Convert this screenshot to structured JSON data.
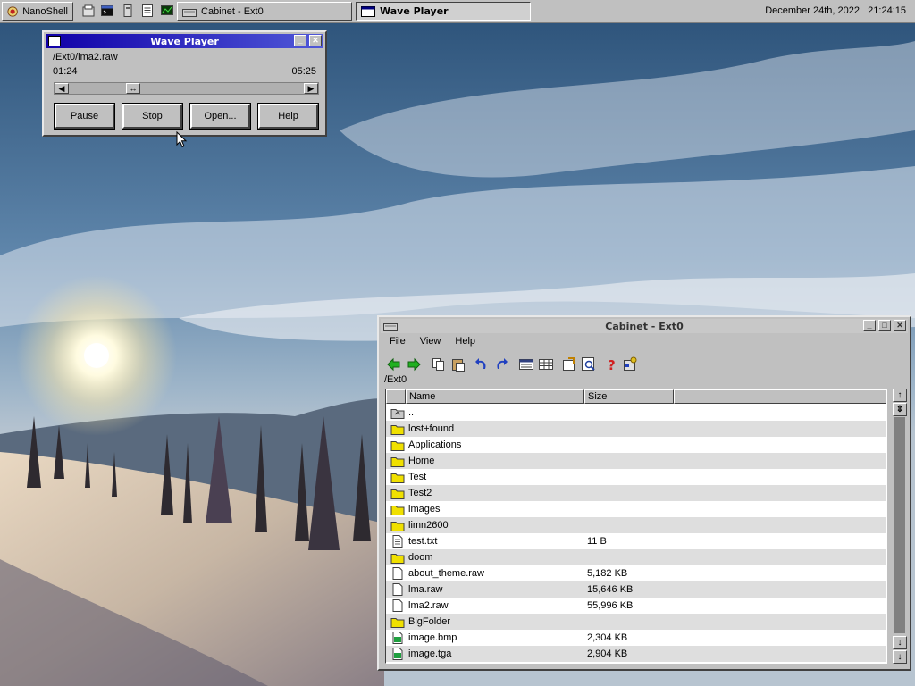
{
  "taskbar": {
    "start_label": "NanoShell",
    "quick_launch": [
      "files-icon",
      "terminal-icon",
      "device-icon",
      "notepad-icon",
      "monitor-icon"
    ],
    "tasks": [
      {
        "label": "Cabinet - Ext0",
        "active": false
      },
      {
        "label": "Wave Player",
        "active": true
      }
    ],
    "date": "December 24th, 2022",
    "time": "21:24:15"
  },
  "wave_player": {
    "title": "Wave Player",
    "file_path": "/Ext0/lma2.raw",
    "position": "01:24",
    "duration": "05:25",
    "progress_fraction": 0.26,
    "buttons": {
      "pause": "Pause",
      "stop": "Stop",
      "open": "Open...",
      "help": "Help"
    },
    "colors": {
      "title_start": "#1000a8",
      "title_end": "#5058d8"
    }
  },
  "cabinet": {
    "title": "Cabinet - Ext0",
    "menu": {
      "file": "File",
      "view": "View",
      "help": "Help"
    },
    "toolbar": [
      "back-icon",
      "forward-icon",
      "copy-icon",
      "paste-icon",
      "undo-icon",
      "redo-icon",
      "view-list-icon",
      "view-details-icon",
      "properties-icon",
      "search-icon",
      "help-icon",
      "settings-icon"
    ],
    "path": "/Ext0",
    "columns": {
      "name": "Name",
      "size": "Size"
    },
    "files": [
      {
        "name": "..",
        "size": "",
        "type": "parent"
      },
      {
        "name": "lost+found",
        "size": "",
        "type": "folder"
      },
      {
        "name": "Applications",
        "size": "",
        "type": "folder"
      },
      {
        "name": "Home",
        "size": "",
        "type": "folder"
      },
      {
        "name": "Test",
        "size": "",
        "type": "folder"
      },
      {
        "name": "Test2",
        "size": "",
        "type": "folder"
      },
      {
        "name": "images",
        "size": "",
        "type": "folder"
      },
      {
        "name": "limn2600",
        "size": "",
        "type": "folder"
      },
      {
        "name": "test.txt",
        "size": "11 B",
        "type": "text"
      },
      {
        "name": "doom",
        "size": "",
        "type": "folder"
      },
      {
        "name": "about_theme.raw",
        "size": "5,182 KB",
        "type": "file"
      },
      {
        "name": "lma.raw",
        "size": "15,646 KB",
        "type": "file"
      },
      {
        "name": "lma2.raw",
        "size": "55,996 KB",
        "type": "file"
      },
      {
        "name": "BigFolder",
        "size": "",
        "type": "folder"
      },
      {
        "name": "image.bmp",
        "size": "2,304 KB",
        "type": "image"
      },
      {
        "name": "image.tga",
        "size": "2,904 KB",
        "type": "image"
      }
    ]
  }
}
